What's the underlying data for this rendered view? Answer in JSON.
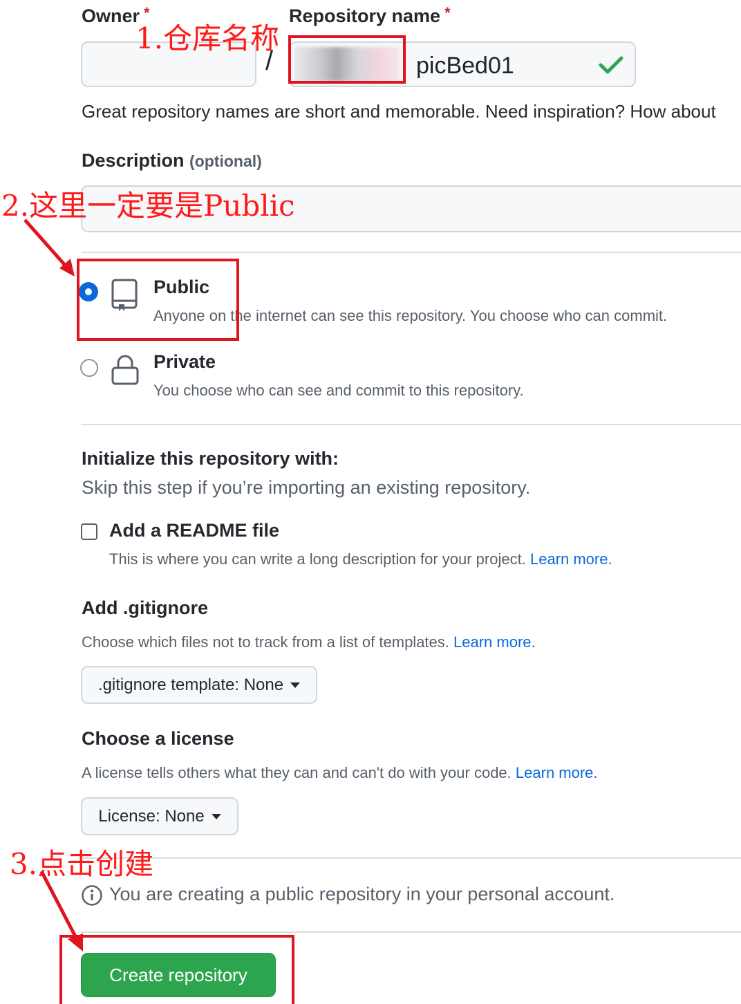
{
  "owner": {
    "label": "Owner",
    "required_mark": "*",
    "value": ""
  },
  "separator": "/",
  "repo_name": {
    "label": "Repository name",
    "required_mark": "*",
    "value": "picBed01"
  },
  "repo_hint": "Great repository names are short and memorable. Need inspiration? How about",
  "description": {
    "label": "Description",
    "optional": "(optional)",
    "value": ""
  },
  "visibility": {
    "public": {
      "title": "Public",
      "desc": "Anyone on the internet can see this repository. You choose who can commit.",
      "checked": true
    },
    "private": {
      "title": "Private",
      "desc": "You choose who can see and commit to this repository.",
      "checked": false
    }
  },
  "initialize": {
    "title": "Initialize this repository with:",
    "subtitle": "Skip this step if you’re importing an existing repository.",
    "readme": {
      "label": "Add a README file",
      "desc": "This is where you can write a long description for your project.",
      "link": "Learn more."
    }
  },
  "gitignore": {
    "title": "Add .gitignore",
    "desc": "Choose which files not to track from a list of templates.",
    "link": "Learn more.",
    "select": ".gitignore template: None"
  },
  "license": {
    "title": "Choose a license",
    "desc": "A license tells others what they can and can't do with your code.",
    "link": "Learn more.",
    "select": "License: None"
  },
  "info_text": "You are creating a public repository in your personal account.",
  "create_button": "Create repository",
  "annotations": {
    "a1": "1.仓库名称",
    "a2": "2.这里一定要是Public",
    "a3": "3.点击创建"
  },
  "colors": {
    "annotation": "#e0141e",
    "primary_button": "#2da44e",
    "link": "#0969da",
    "checkmark": "#2da44e"
  }
}
